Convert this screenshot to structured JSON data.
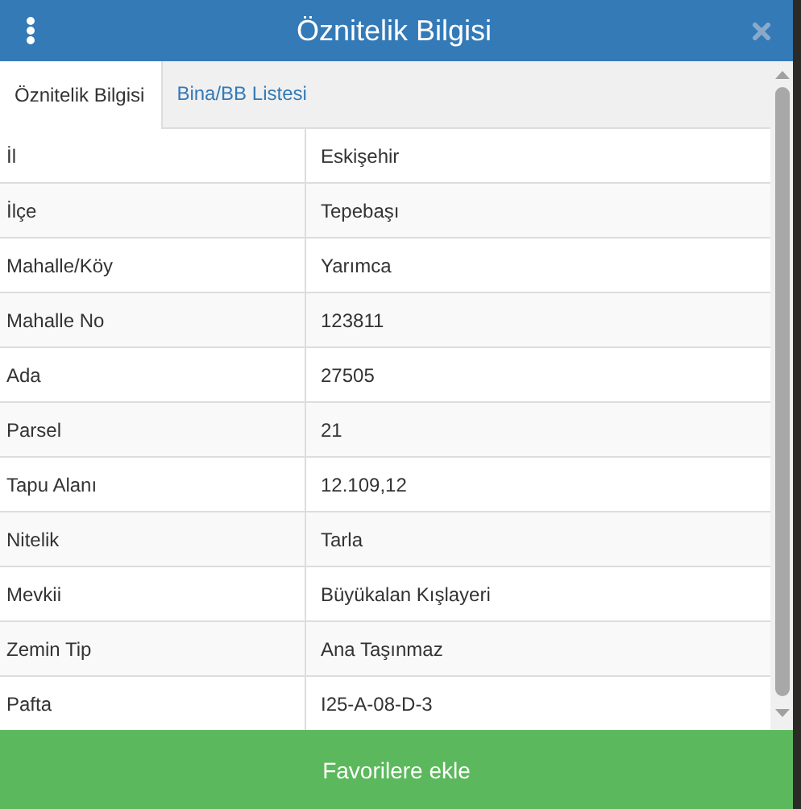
{
  "header": {
    "title": "Öznitelik Bilgisi"
  },
  "tabs": [
    {
      "label": "Öznitelik Bilgisi",
      "selected": true
    },
    {
      "label": "Bina/BB Listesi",
      "selected": false
    }
  ],
  "table": {
    "rows": [
      {
        "label": "İl",
        "value": "Eskişehir"
      },
      {
        "label": "İlçe",
        "value": "Tepebaşı"
      },
      {
        "label": "Mahalle/Köy",
        "value": "Yarımca"
      },
      {
        "label": "Mahalle No",
        "value": "123811"
      },
      {
        "label": "Ada",
        "value": "27505"
      },
      {
        "label": "Parsel",
        "value": "21"
      },
      {
        "label": "Tapu Alanı",
        "value": "12.109,12"
      },
      {
        "label": "Nitelik",
        "value": "Tarla"
      },
      {
        "label": "Mevkii",
        "value": "Büyükalan Kışlayeri"
      },
      {
        "label": "Zemin Tip",
        "value": "Ana Taşınmaz"
      },
      {
        "label": "Pafta",
        "value": "I25-A-08-D-3"
      }
    ]
  },
  "footer_button": {
    "label": "Favorilere ekle"
  }
}
